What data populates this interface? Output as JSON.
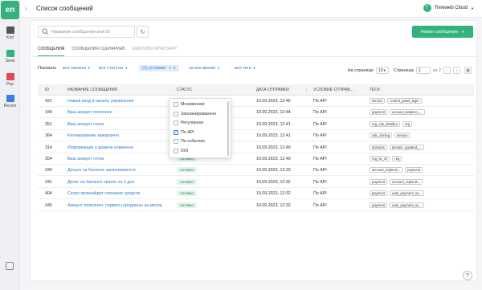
{
  "app": {
    "logo": "en",
    "page_title": "Список сообщений",
    "account": "Timeweb Cloud",
    "account_initial": "T"
  },
  "rail": [
    {
      "label": "Kod",
      "icon": "code-icon",
      "color": "#555555"
    },
    {
      "label": "Send",
      "icon": "send-icon",
      "color": "#34b27b"
    },
    {
      "label": "Pop",
      "icon": "pop-icon",
      "color": "#e2465a"
    },
    {
      "label": "Recom",
      "icon": "recom-icon",
      "color": "#3d7fd9"
    }
  ],
  "toolbar": {
    "search_placeholder": "Название сообщения или ID",
    "new_label": "Новое сообщение"
  },
  "tabs": [
    "СООБЩЕНИЯ",
    "СООБЩЕНИЯ СЦЕНАРИЕВ",
    "ШАБЛОНЫ WHATSAPP"
  ],
  "filters": {
    "show_label": "Показать",
    "channels": "все каналы",
    "statuses": "все статусы",
    "condition": "(1) условие",
    "time": "за все время",
    "tags": "все теги"
  },
  "pager": {
    "per_page_label": "На странице",
    "per_page": "10",
    "page_label": "Страница",
    "page": "1",
    "of": "из 2"
  },
  "columns": [
    "ID",
    "НАЗВАНИЕ СООБЩЕНИЯ",
    "СТАТУС",
    "ДАТА ОТПРАВКИ",
    "УСЛОВИЕ ОТПРАВ...",
    "ТЕГИ"
  ],
  "rows": [
    {
      "id": "421",
      "name": "Новый вход в панель управления",
      "status": "Активно",
      "date": "19.09.2023, 12:45",
      "cond": "По API",
      "tags": [
        "service",
        "control_panel_login"
      ]
    },
    {
      "id": "344",
      "name": "Ваш аккаунт пополнен",
      "status": "Активно",
      "date": "19.09.2023, 12:44",
      "cond": "По API",
      "tags": [
        "payment",
        "account_balance_..."
      ]
    },
    {
      "id": "351",
      "name": "Ваш аккаунт готов",
      "status": "Активно",
      "date": "19.09.2023, 12:41",
      "cond": "По API",
      "tags": [
        "reg_vds_distribut",
        "reg"
      ]
    },
    {
      "id": "364",
      "name": "Клонирование завершено",
      "status": "Активно",
      "date": "19.09.2023, 12:41",
      "cond": "По API",
      "tags": [
        "vds_cloning",
        "service"
      ]
    },
    {
      "id": "314",
      "name": "Информация о домене изменена",
      "status": "Активно",
      "date": "19.09.2023, 12:40",
      "cond": "По API",
      "tags": [
        "domains",
        "domain_updated_..."
      ]
    },
    {
      "id": "354",
      "name": "Ваш аккаунт готов",
      "status": "Активно",
      "date": "19.09.2023, 12:40",
      "cond": "По API",
      "tags": [
        "reg_tw_vh",
        "reg"
      ]
    },
    {
      "id": "340",
      "name": "Деньги на балансе заканчиваются",
      "status": "Активно",
      "date": "19.09.2023, 12:33",
      "cond": "По API",
      "tags": [
        "account_replenis...",
        "payment"
      ]
    },
    {
      "id": "341",
      "name": "Денег на балансе хватит на 3 дня",
      "status": "Активно",
      "date": "19.09.2023, 12:32",
      "cond": "По API",
      "tags": [
        "payment",
        "account_replenis..."
      ]
    },
    {
      "id": "404",
      "name": "Скоро произойдет списание средств",
      "status": "Активно",
      "date": "19.09.2023, 12:32",
      "cond": "По API",
      "tags": [
        "payment",
        "auto_payment_su..."
      ]
    },
    {
      "id": "345",
      "name": "Аккаунт пополнен: сервисы продлены на месяц",
      "status": "Активно",
      "date": "19.09.2023, 12:32",
      "cond": "По API",
      "tags": [
        "payment",
        "auto_payment_su..."
      ]
    }
  ],
  "dropdown": [
    {
      "label": "Мгновенное",
      "checked": false
    },
    {
      "label": "Запланированное",
      "checked": false
    },
    {
      "label": "Регулярное",
      "checked": false
    },
    {
      "label": "По API",
      "checked": true
    },
    {
      "label": "По событию",
      "checked": false
    },
    {
      "label": "DOI",
      "checked": false
    }
  ],
  "help": "?"
}
